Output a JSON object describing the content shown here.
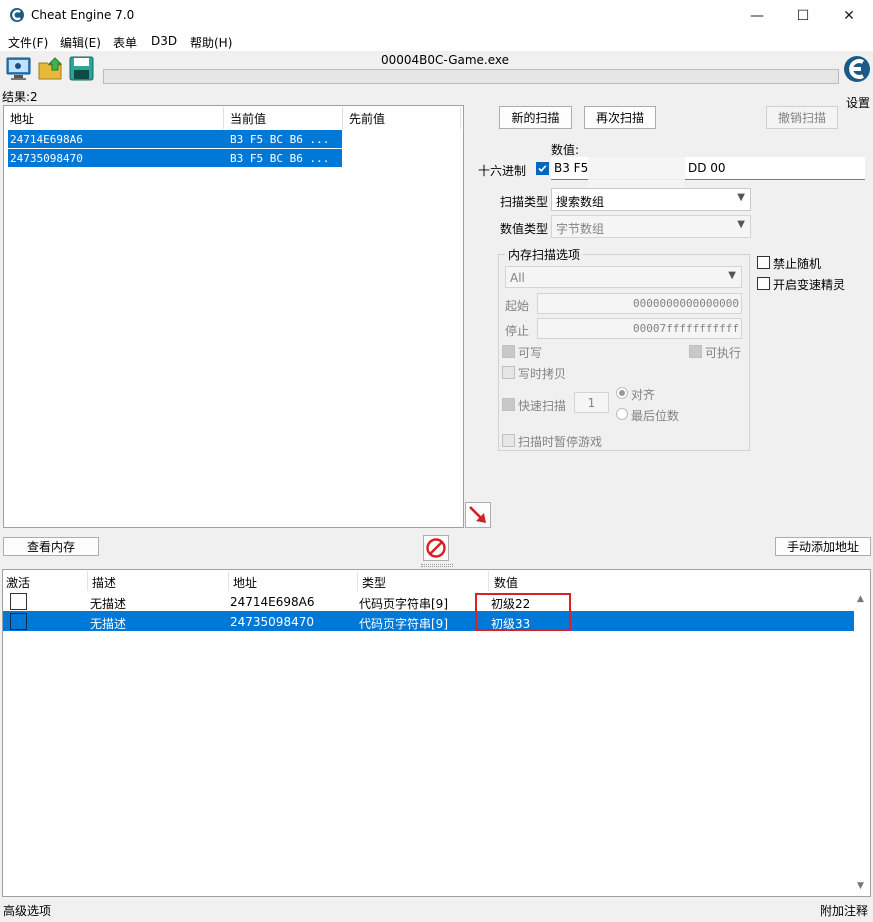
{
  "window": {
    "title": "Cheat Engine 7.0",
    "minimize": "—",
    "maximize": "☐",
    "close": "✕"
  },
  "menu": [
    "文件(F)",
    "编辑(E)",
    "表单",
    "D3D",
    "帮助(H)"
  ],
  "toolbar": {
    "process_name": "00004B0C-Game.exe",
    "settings_label": "设置",
    "progress_percent": 0
  },
  "results": {
    "count_label": "结果:2"
  },
  "result_list": {
    "columns": [
      "地址",
      "当前值",
      "先前值"
    ],
    "rows": [
      {
        "address": "24714E698A6",
        "current": "B3 F5 BC B6 ...",
        "previous": ""
      },
      {
        "address": "24735098470",
        "current": "B3 F5 BC B6 ...",
        "previous": ""
      }
    ]
  },
  "scan": {
    "new_scan": "新的扫描",
    "next_scan": "再次扫描",
    "undo_scan": "撤销扫描",
    "value_label": "数值:",
    "hex_label": "十六进制",
    "hex_checked": true,
    "value_prefix": "B3 F5",
    "value_suffix": "DD 00",
    "scan_type_label": "扫描类型",
    "scan_type_value": "搜索数组",
    "value_type_label": "数值类型",
    "value_type_value": "字节数组",
    "no_random": "禁止随机",
    "speedhack": "开启变速精灵"
  },
  "memory_options": {
    "title": "内存扫描选项",
    "region": "All",
    "start_label": "起始",
    "start_value": "0000000000000000",
    "stop_label": "停止",
    "stop_value": "00007fffffffffff",
    "writable": "可写",
    "executable": "可执行",
    "copy_on_write": "写时拷贝",
    "fast_scan": "快速扫描",
    "fast_scan_value": "1",
    "align": "对齐",
    "last_digits": "最后位数",
    "pause_game": "扫描时暂停游戏"
  },
  "buttons": {
    "view_memory": "查看内存",
    "add_address": "手动添加地址"
  },
  "address_list": {
    "columns": [
      "激活",
      "描述",
      "地址",
      "类型",
      "数值"
    ],
    "rows": [
      {
        "desc": "无描述",
        "address": "24714E698A6",
        "type": "代码页字符串[9]",
        "value": "初级22"
      },
      {
        "desc": "无描述",
        "address": "24735098470",
        "type": "代码页字符串[9]",
        "value": "初级33"
      }
    ]
  },
  "status": {
    "left": "高级选项",
    "right": "附加注释"
  },
  "colors": {
    "selection": "#0078d7",
    "highlight_box": "#e02020"
  }
}
